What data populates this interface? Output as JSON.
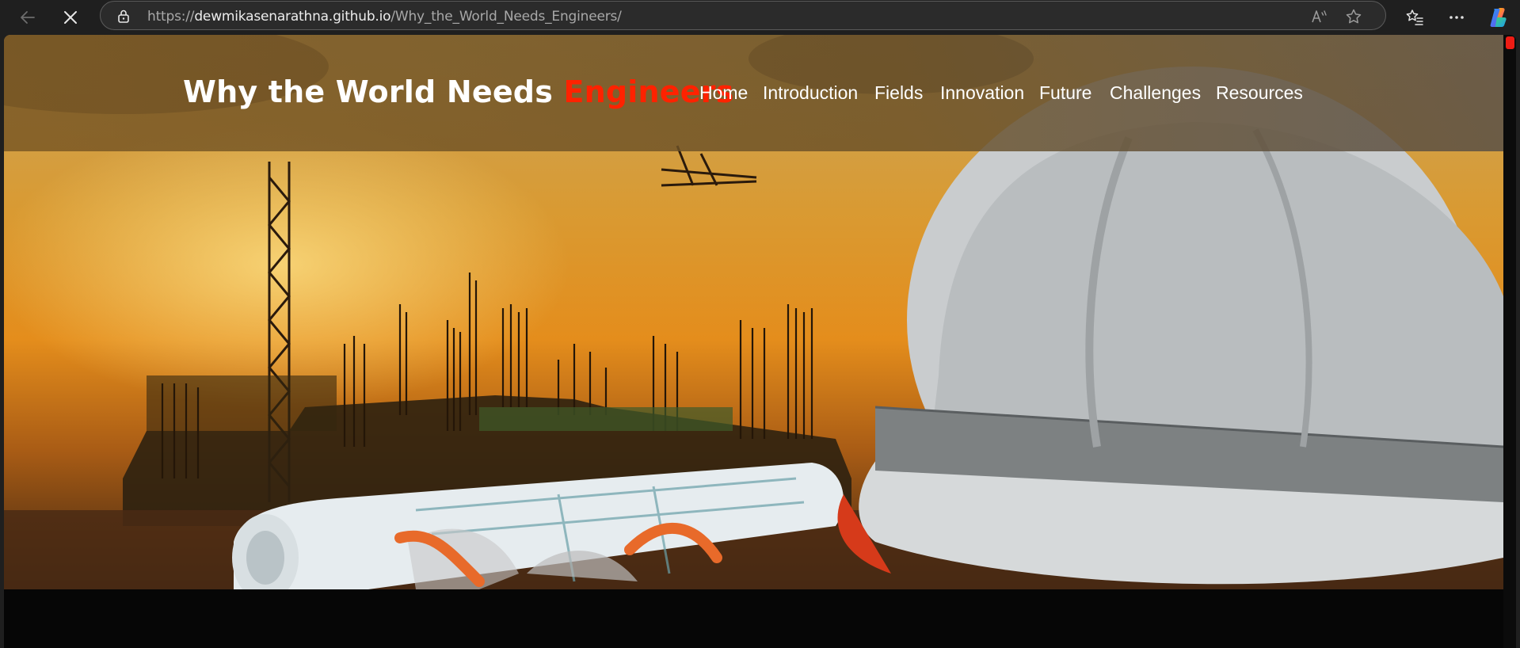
{
  "browser": {
    "url_scheme": "https://",
    "url_host": "dewmikasenarathna.github.io",
    "url_path": "/Why_the_World_Needs_Engineers/",
    "icons": [
      "back-arrow-icon",
      "stop-loading-icon",
      "lock-icon",
      "read-aloud-icon",
      "favorite-star-icon",
      "favorites-icon",
      "more-menu-icon",
      "copilot-icon"
    ]
  },
  "site": {
    "title_main": "Why the World Needs ",
    "title_accent": "Engineers",
    "accent_color": "#ff2200"
  },
  "nav": {
    "items": [
      {
        "label": "Home"
      },
      {
        "label": "Introduction"
      },
      {
        "label": "Fields"
      },
      {
        "label": "Innovation"
      },
      {
        "label": "Future"
      },
      {
        "label": "Challenges"
      },
      {
        "label": "Resources"
      }
    ]
  },
  "scrollbar": {
    "thumb_color": "#ee1c14"
  }
}
